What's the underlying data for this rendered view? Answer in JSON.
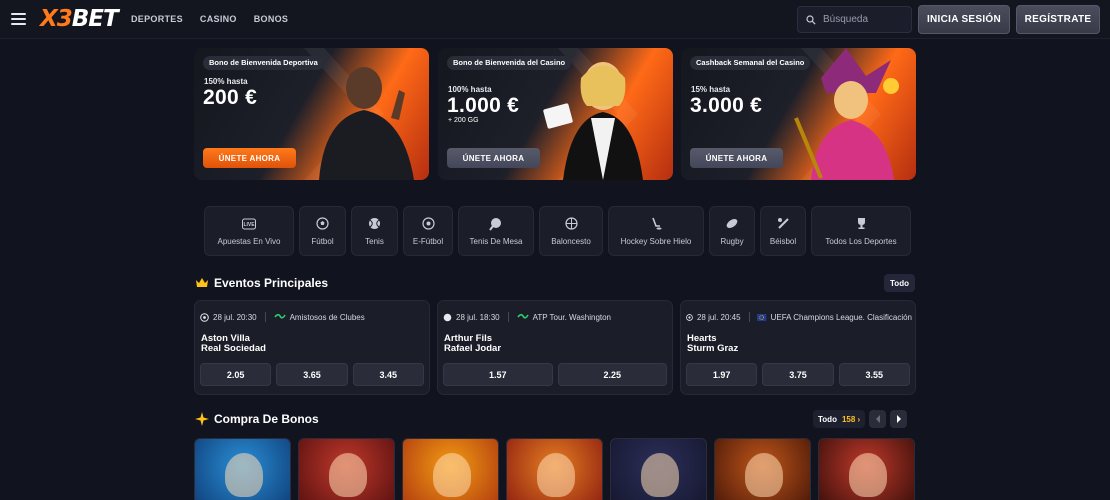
{
  "header": {
    "logo": {
      "x": "X",
      "three": "3",
      "bet": "BET"
    },
    "nav": [
      "DEPORTES",
      "CASINO",
      "BONOS"
    ],
    "search": {
      "placeholder": "Búsqueda",
      "icon": "search-icon"
    },
    "login_label": "INICIA SESIÓN",
    "register_label": "REGÍSTRATE"
  },
  "promos": [
    {
      "tag": "Bono de Bienvenida Deportiva",
      "pre": "150% hasta",
      "amount": "200 €",
      "sub": "",
      "cta": "ÚNETE AHORA",
      "cta_style": "orange"
    },
    {
      "tag": "Bono de Bienvenida del Casino",
      "pre": "100% hasta",
      "amount": "1.000 €",
      "sub": "+ 200 GG",
      "cta": "ÚNETE AHORA",
      "cta_style": "grey"
    },
    {
      "tag": "Cashback Semanal del Casino",
      "pre": "15% hasta",
      "amount": "3.000 €",
      "sub": "",
      "cta": "ÚNETE AHORA",
      "cta_style": "grey"
    }
  ],
  "categories": [
    {
      "label": "Apuestas En Vivo",
      "icon": "live-icon"
    },
    {
      "label": "Fútbol",
      "icon": "soccer-ball-icon"
    },
    {
      "label": "Tenis",
      "icon": "tennis-ball-icon"
    },
    {
      "label": "E-Fútbol",
      "icon": "esoccer-icon"
    },
    {
      "label": "Tenis De Mesa",
      "icon": "table-tennis-icon"
    },
    {
      "label": "Baloncesto",
      "icon": "basketball-icon"
    },
    {
      "label": "Hockey Sobre Hielo",
      "icon": "hockey-icon"
    },
    {
      "label": "Rugby",
      "icon": "rugby-ball-icon"
    },
    {
      "label": "Béisbol",
      "icon": "baseball-icon"
    },
    {
      "label": "Todos Los Deportes",
      "icon": "trophy-icon"
    }
  ],
  "events_section": {
    "title": "Eventos Principales",
    "all_label": "Todo",
    "icon": "crown-icon"
  },
  "events": [
    {
      "time": "28 jul. 20:30",
      "league": "Amistosos de Clubes",
      "team1": "Aston Villa",
      "team2": "Real Sociedad",
      "odds": [
        "2.05",
        "3.65",
        "3.45"
      ]
    },
    {
      "time": "28 jul. 18:30",
      "league": "ATP Tour. Washington",
      "team1": "Arthur Fils",
      "team2": "Rafael Jodar",
      "odds": [
        "1.57",
        "2.25"
      ]
    },
    {
      "time": "28 jul. 20:45",
      "league": "UEFA Champions League. Clasificación",
      "team1": "Hearts",
      "team2": "Sturm Graz",
      "odds": [
        "1.97",
        "3.75",
        "3.55"
      ]
    }
  ],
  "bonus_section": {
    "title": "Compra De Bonos",
    "all_label": "Todo",
    "count": "158 ›",
    "icon": "sparkle-icon"
  },
  "games": [
    {
      "name": "game-tile-1",
      "colors": [
        "#2a8fd6",
        "#0f3f7a"
      ]
    },
    {
      "name": "game-tile-2",
      "colors": [
        "#c0392b",
        "#5a1010"
      ]
    },
    {
      "name": "game-tile-3",
      "colors": [
        "#f39c12",
        "#b03a10"
      ]
    },
    {
      "name": "game-tile-4",
      "colors": [
        "#e67e22",
        "#8e1f10"
      ]
    },
    {
      "name": "game-tile-5",
      "colors": [
        "#2c2f5a",
        "#15172e"
      ]
    },
    {
      "name": "game-tile-6",
      "colors": [
        "#c0561a",
        "#4a1808"
      ]
    },
    {
      "name": "game-tile-7",
      "colors": [
        "#c0392b",
        "#3a0f0a"
      ]
    }
  ],
  "colors": {
    "accent": "#ff7a1a",
    "background": "#11131f",
    "card": "#1b1d28",
    "count": "#ffc21a"
  }
}
